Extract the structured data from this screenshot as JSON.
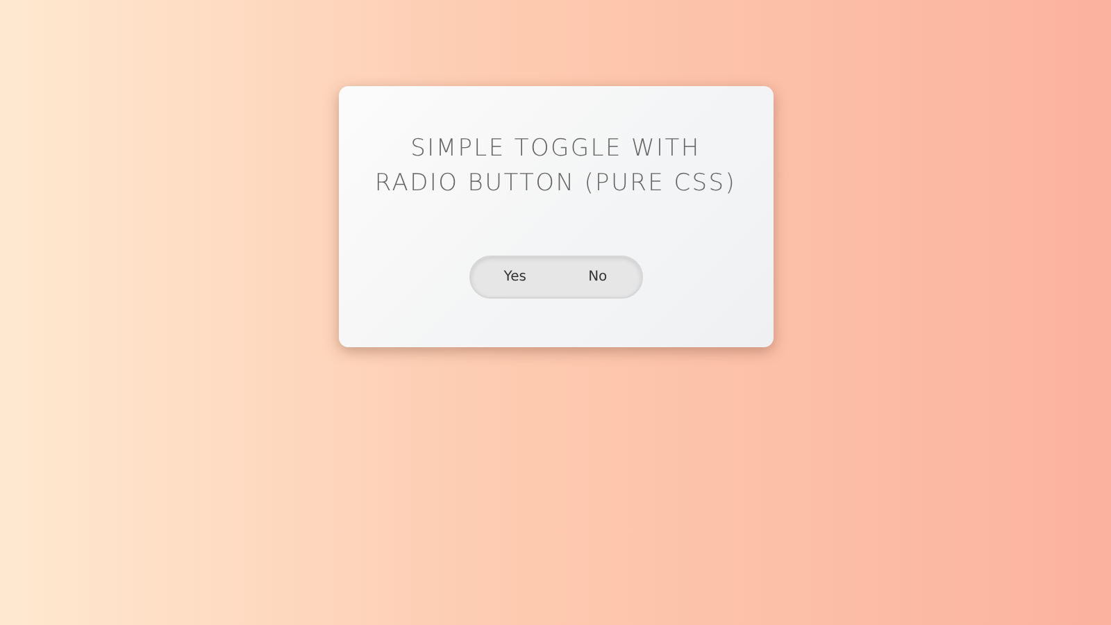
{
  "card": {
    "title_lines": [
      "SIMPLE TOGGLE WITH",
      "RADIO BUTTON (PURE CSS)"
    ]
  },
  "toggle": {
    "options": [
      {
        "label": "Yes",
        "selected": false
      },
      {
        "label": "No",
        "selected": false
      }
    ]
  }
}
